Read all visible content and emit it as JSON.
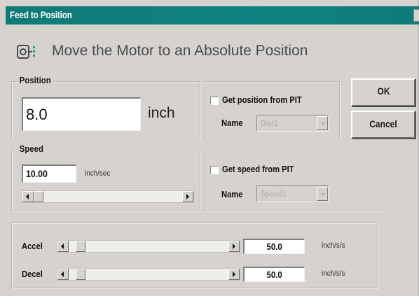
{
  "window": {
    "title": "Feed to Position"
  },
  "header": {
    "text": "Move the Motor to an Absolute Position",
    "icon": "motor-icon"
  },
  "position": {
    "group_label": "Position",
    "value": "8.0",
    "unit": "inch",
    "pit_checkbox_label": "Get position from PIT",
    "pit_checked": false,
    "name_label": "Name",
    "name_value": "Dist1"
  },
  "buttons": {
    "ok": "OK",
    "cancel": "Cancel"
  },
  "speed": {
    "group_label": "Speed",
    "value": "10.00",
    "unit": "inch/sec",
    "pit_checkbox_label": "Get speed from PIT",
    "pit_checked": false,
    "name_label": "Name",
    "name_value": "Speed1"
  },
  "accel": {
    "label": "Accel",
    "value": "50.0",
    "unit": "inch/s/s"
  },
  "decel": {
    "label": "Decel",
    "value": "50.0",
    "unit": "inch/s/s"
  },
  "colors": {
    "titlebar": "#0f7a78",
    "window_bg": "#d6d3ce"
  }
}
